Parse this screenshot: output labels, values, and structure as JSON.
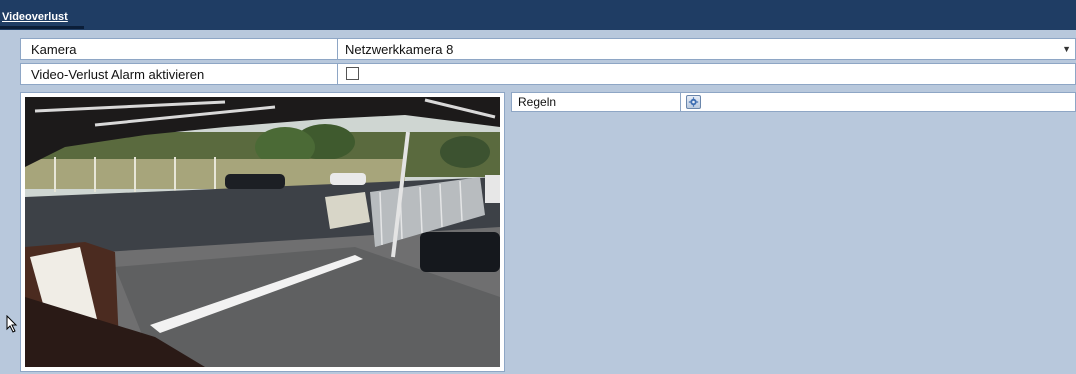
{
  "header": {
    "tab_label": "Videoverlust"
  },
  "form": {
    "camera_label": "Kamera",
    "camera_value": "Netzwerkkamera 8",
    "alarm_label": "Video-Verlust Alarm aktivieren",
    "alarm_checked": false
  },
  "rules": {
    "label": "Regeln",
    "settings_icon": "gear-icon"
  },
  "preview": {
    "description_icon": "camera-preview-image"
  },
  "colors": {
    "titlebar": "#1f3d64",
    "panel": "#b8c8dc",
    "border": "#8ea6c5"
  }
}
